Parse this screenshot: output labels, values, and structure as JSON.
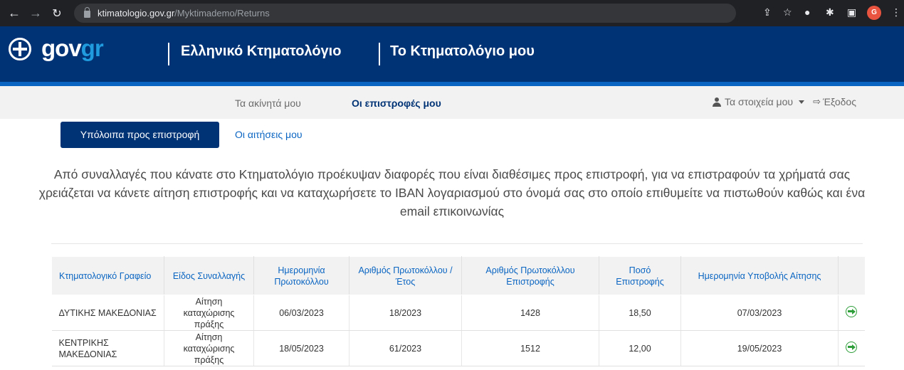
{
  "browser": {
    "url_host": "ktimatologio.gov.gr",
    "url_path": "/Myktimademo/Returns",
    "profile_initial": "G"
  },
  "header": {
    "logo_gov": "gov",
    "logo_gr": "gr",
    "title_1": "Ελληνικό Κτηματολόγιο",
    "title_2": "Το Κτηματολόγιο μου"
  },
  "subnav": {
    "properties": "Τα ακίνητά μου",
    "returns": "Οι επιστροφές μου",
    "my_details": "Τα στοιχεία μου",
    "logout": "Έξοδος"
  },
  "tabs": {
    "active": "Υπόλοιπα προς επιστροφή",
    "requests": "Οι αιτήσεις μου"
  },
  "intro": "Από συναλλαγές που κάνατε στο Κτηματολόγιο προέκυψαν διαφορές που είναι διαθέσιμες προς επιστροφή, για να επιστραφούν τα χρήματά σας χρειάζεται να κάνετε αίτηση επιστροφής και να καταχωρήσετε το IBAN λογαριασμού στο όνομά σας στο οποίο επιθυμείτε να πιστωθούν καθώς και ένα email επικοινωνίας",
  "table": {
    "headers": [
      "Κτηματολογικό Γραφείο",
      "Είδος Συναλλαγής",
      "Ημερομηνία Πρωτοκόλλου",
      "Αριθμός Πρωτοκόλλου / Έτος",
      "Αριθμός Πρωτοκόλλου Επιστροφής",
      "Ποσό Επιστροφής",
      "Ημερομηνία Υποβολής Αίτησης"
    ],
    "rows": [
      [
        "ΔΥΤΙΚΗΣ ΜΑΚΕΔΟΝΙΑΣ",
        "Αίτηση καταχώρισης πράξης",
        "06/03/2023",
        "18/2023",
        "1428",
        "18,50",
        "07/03/2023"
      ],
      [
        "ΚΕΝΤΡΙΚΗΣ ΜΑΚΕΔΟΝΙΑΣ",
        "Αίτηση καταχώρισης πράξης",
        "18/05/2023",
        "61/2023",
        "1512",
        "12,00",
        "19/05/2023"
      ]
    ]
  },
  "colors": {
    "primary": "#003375",
    "accent": "#0a65c2",
    "action": "#2e9e3a"
  }
}
